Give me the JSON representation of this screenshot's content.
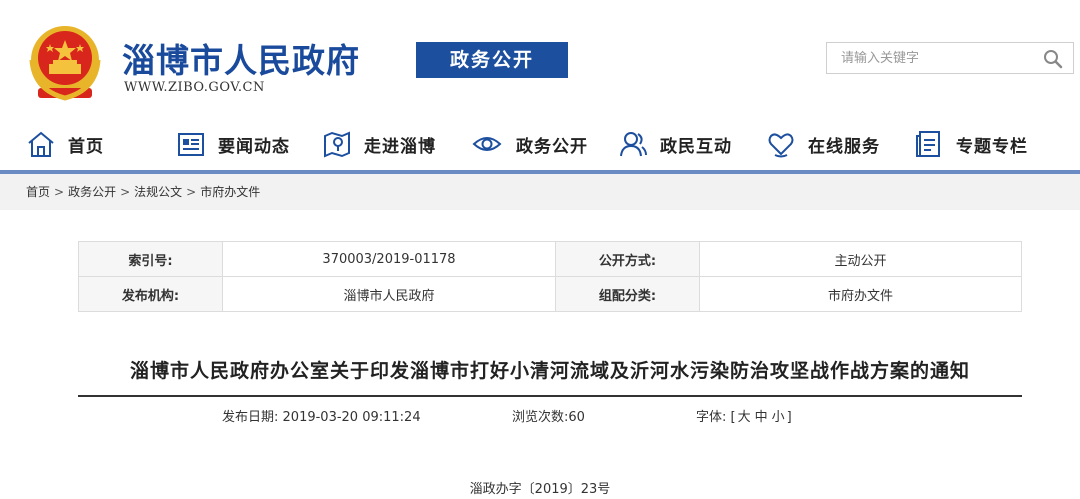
{
  "header": {
    "site_name": "淄博市人民政府",
    "site_url": "WWW.ZIBO.GOV.CN",
    "section_badge": "政务公开",
    "search_placeholder": "请输入关键字"
  },
  "nav": {
    "items": [
      {
        "label": "首页",
        "icon": "home-icon"
      },
      {
        "label": "要闻动态",
        "icon": "news-icon"
      },
      {
        "label": "走进淄博",
        "icon": "map-icon"
      },
      {
        "label": "政务公开",
        "icon": "eye-icon"
      },
      {
        "label": "政民互动",
        "icon": "people-icon"
      },
      {
        "label": "在线服务",
        "icon": "heart-icon"
      },
      {
        "label": "专题专栏",
        "icon": "document-icon"
      }
    ]
  },
  "breadcrumb": {
    "items": [
      "首页",
      "政务公开",
      "法规公文",
      "市府办文件"
    ],
    "separator": ">"
  },
  "meta": {
    "index_label": "索引号:",
    "index_value": "370003/2019-01178",
    "disclosure_label": "公开方式:",
    "disclosure_value": "主动公开",
    "publisher_label": "发布机构:",
    "publisher_value": "淄博市人民政府",
    "category_label": "组配分类:",
    "category_value": "市府办文件"
  },
  "article": {
    "title": "淄博市人民政府办公室关于印发淄博市打好小清河流域及沂河水污染防治攻坚战作战方案的通知",
    "publish_date_label": "发布日期:",
    "publish_date": "2019-03-20 09:11:24",
    "views_label": "浏览次数:",
    "views": "60",
    "font_label": "字体:",
    "font_open": "[",
    "font_large": "大",
    "font_medium": "中",
    "font_small": "小",
    "font_close": "]",
    "doc_number": "淄政办字〔2019〕23号"
  },
  "colors": {
    "brand_blue": "#1d4f9f",
    "nav_underline": "#6a8bc3",
    "emblem_red": "#d8261c",
    "emblem_gold": "#f4c23d"
  }
}
